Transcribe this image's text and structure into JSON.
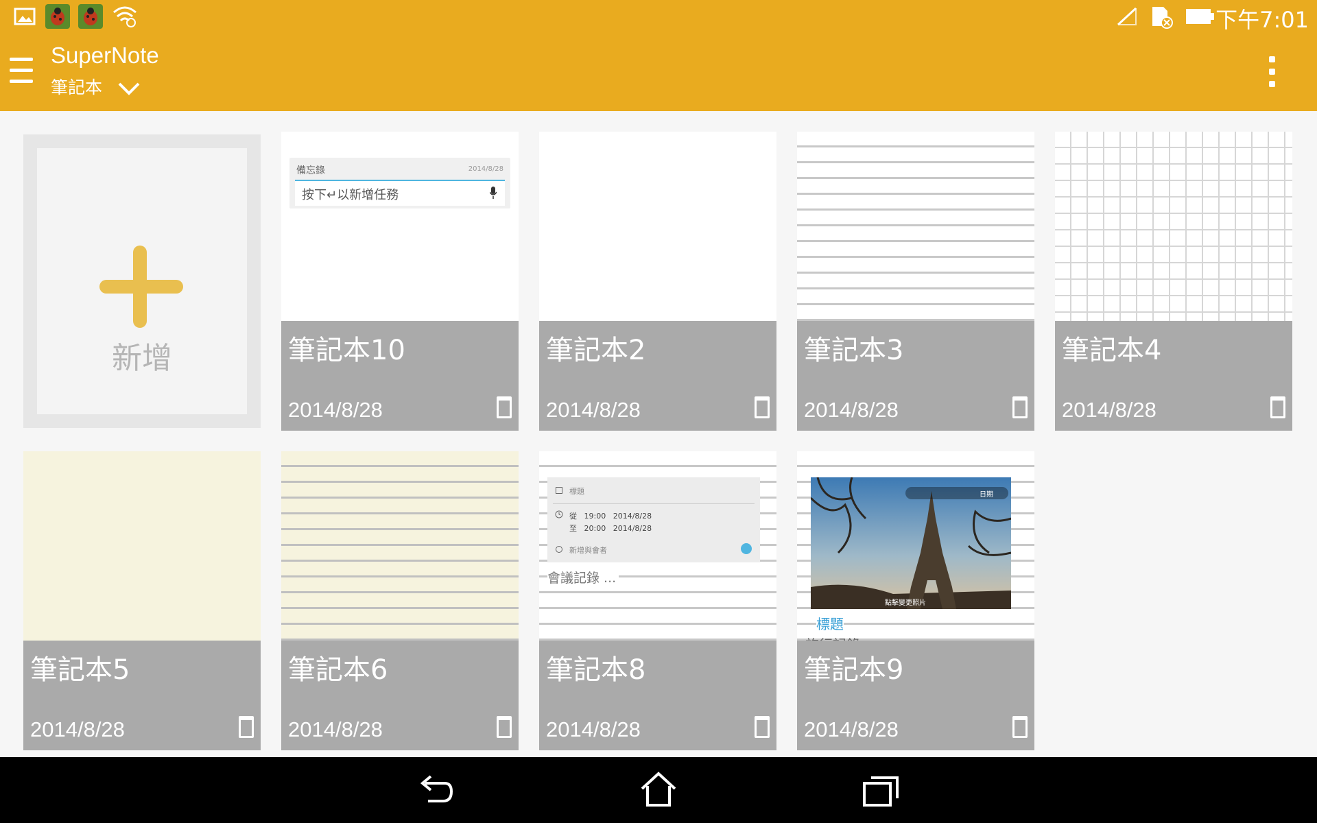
{
  "status_bar": {
    "time": "下午7:01",
    "left_icons": [
      "gallery-icon",
      "bug-app-icon",
      "bug-app-icon",
      "wifi-question-icon"
    ],
    "right_icons": [
      "signal-off-icon",
      "sdcard-error-icon",
      "battery-icon"
    ]
  },
  "app_bar": {
    "title": "SuperNote",
    "subtitle": "筆記本",
    "accent_color": "#e9ab1f"
  },
  "add_card": {
    "label": "新增"
  },
  "notebooks": [
    {
      "name": "筆記本10",
      "date": "2014/8/28",
      "template": "memo"
    },
    {
      "name": "筆記本2",
      "date": "2014/8/28",
      "template": "blank"
    },
    {
      "name": "筆記本3",
      "date": "2014/8/28",
      "template": "lined"
    },
    {
      "name": "筆記本4",
      "date": "2014/8/28",
      "template": "grid"
    },
    {
      "name": "筆記本5",
      "date": "2014/8/28",
      "template": "cream"
    },
    {
      "name": "筆記本6",
      "date": "2014/8/28",
      "template": "lined-cream"
    },
    {
      "name": "筆記本8",
      "date": "2014/8/28",
      "template": "meeting"
    },
    {
      "name": "筆記本9",
      "date": "2014/8/28",
      "template": "travel"
    }
  ],
  "memo_preview": {
    "label": "備忘錄",
    "date": "2014/8/28",
    "placeholder": "按下↵以新增任務"
  },
  "meeting_preview": {
    "title": "標題",
    "from_label": "從",
    "from_time": "19:00",
    "from_date": "2014/8/28",
    "to_label": "至",
    "to_time": "20:00",
    "to_date": "2014/8/28",
    "guests": "新增與會者",
    "minutes": "會議記錄 ..."
  },
  "travel_preview": {
    "date_chip": "日期",
    "change_photo": "點擊變更照片",
    "title": "標題",
    "subtitle": "旅行記錄"
  },
  "nav_bar": {
    "buttons": [
      "back-icon",
      "home-icon",
      "recents-icon"
    ]
  }
}
